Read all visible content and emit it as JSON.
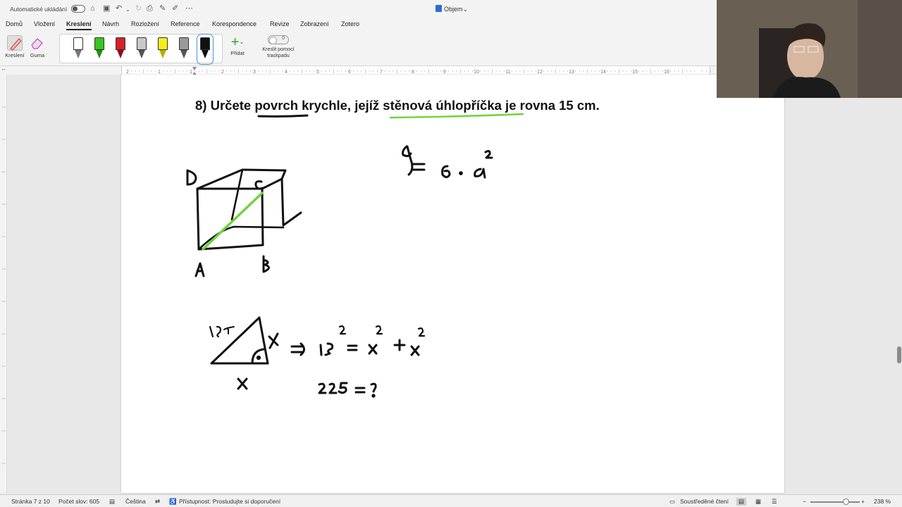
{
  "titlebar": {
    "autosave_label": "Automatické ukládání",
    "document_name": "Objem",
    "title_chevron": "⌄"
  },
  "tabs": [
    "Domů",
    "Vložení",
    "Kreslení",
    "Návrh",
    "Rozložení",
    "Reference",
    "Korespondence",
    "Revize",
    "Zobrazení",
    "Zotero"
  ],
  "active_tab": "Kreslení",
  "ribbon": {
    "draw_label": "Kreslení",
    "eraser_label": "Guma",
    "add_label": "Přidat",
    "trackpad_label": "Kreslit pomocí trackpadu",
    "trackpad_toggle_text": "0",
    "pens": [
      {
        "color": "#ffffff",
        "tip": "#777777"
      },
      {
        "color": "#39c41e",
        "tip": "#2a8a14"
      },
      {
        "color": "#d81f26",
        "tip": "#8a1015"
      },
      {
        "color": "#c8c8c8",
        "tip": "#555555"
      },
      {
        "color": "#f4ec1c",
        "tip": "#b8ae00"
      },
      {
        "color": "#9a9a9a",
        "tip": "#555555"
      },
      {
        "color": "#111111",
        "tip": "#111111"
      }
    ]
  },
  "ruler": {
    "numbers": [
      "2",
      "1",
      "1",
      "2",
      "3",
      "4",
      "5",
      "6",
      "7",
      "8",
      "9",
      "10",
      "11",
      "12",
      "13",
      "14",
      "15",
      "16"
    ]
  },
  "document": {
    "question": "8)  Určete povrch krychle, jejíž stěnová úhlopříčka je rovna 15 cm.",
    "handwriting": {
      "cube_labels": [
        "D",
        "C",
        "A",
        "B"
      ],
      "formula_surface": "S = 6 · a²",
      "triangle_hyp": "15",
      "triangle_leg_side": "x",
      "triangle_leg_bottom": "x",
      "equation": "=> 15² = x² + x²",
      "result": "225 = ?"
    }
  },
  "statusbar": {
    "page": "Stránka 7 z 10",
    "words": "Počet slov: 605",
    "language": "Čeština",
    "accessibility": "Přístupnost: Prostudujte si doporučení",
    "focus": "Soustředěné čtení",
    "zoom": "238 %"
  },
  "colors": {
    "ink": "#111111",
    "highlight_green": "#6fd33a",
    "app_chrome": "#f3f3f3"
  }
}
